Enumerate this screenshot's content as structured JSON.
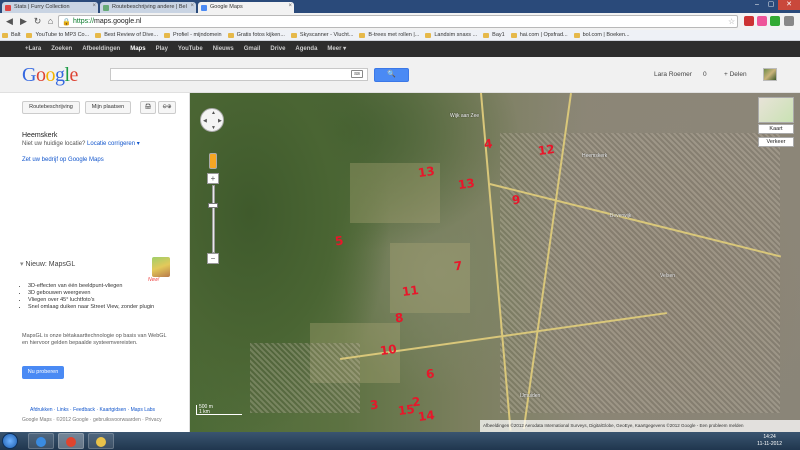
{
  "browser": {
    "tabs": [
      {
        "label": "Stats | Furry Collection",
        "color": "#d44"
      },
      {
        "label": "Routebeschrijving andere | Bel",
        "color": "#6a7"
      },
      {
        "label": "Google Maps",
        "color": "#4a8af4",
        "active": true
      }
    ],
    "url_scheme": "https://",
    "url_host": "maps.google.nl",
    "window_buttons": [
      "–",
      "▢",
      "✕"
    ]
  },
  "bookmarks": [
    "Balt",
    "YouTube to MP3 Co...",
    "Best Review of Dive...",
    "Profiel - mijndomein",
    "Gratis fotos kijken...",
    "Skyscanner - Vlucht...",
    "B-trees met rollen |...",
    "Landsim snaxs ...",
    "Bay1",
    "hai.com | Opsfrad...",
    "bol.com | Boeken..."
  ],
  "google_bar": {
    "items": [
      "+Lara",
      "Zoeken",
      "Afbeeldingen",
      "Maps",
      "Play",
      "YouTube",
      "Nieuws",
      "Gmail",
      "Drive",
      "Agenda",
      "Meer ▾"
    ],
    "selected": "Maps"
  },
  "header": {
    "logo": [
      "G",
      "o",
      "o",
      "g",
      "l",
      "e"
    ],
    "search_value": "",
    "search_button": "🔍",
    "username": "Lara Roemer",
    "notifications": "0",
    "share": "+ Delen"
  },
  "left_panel": {
    "buttons": [
      "Routebeschrijving",
      "Mijn plaatsen",
      "🖨",
      "⊖⊕"
    ],
    "place_title": "Heemskerk",
    "place_subtitle": "Niet uw huidige locatie?",
    "place_link": "Locatie corrigeren ▾",
    "mymaps_link": "Zet uw bedrijf op Google Maps",
    "mapsgl": {
      "title": "Nieuw: MapsGL",
      "badge": "New!",
      "features": [
        "3D-effecten van één beeldpunt-vliegen",
        "3D gebouwen weergeven",
        "Vliegen over 45° luchtfoto's",
        "Snel omlaag duiken naar Street View, zonder plugin"
      ],
      "description": "MapsGL is onze bètakaarttechnologie op basis van WebGL en hiervoor gelden bepaalde systeemvereisten.",
      "button": "Nu proberen"
    },
    "footer_links": "Afdrukken · Links · Feedback · Kaartgidsen · Maps Labs",
    "footer_copy": "Google Maps · ©2012 Google · gebruiksvoorwaarden · Privacy"
  },
  "map": {
    "labels": [
      "4",
      "12",
      "13",
      "13",
      "9",
      "5",
      "7",
      "11",
      "8",
      "10",
      "6",
      "3",
      "15",
      "2",
      "14"
    ],
    "places": [
      "Heemskerk",
      "Beverwijk",
      "Velsen",
      "Wijk aan Zee",
      "IJmuiden"
    ],
    "maptype": "Kaart",
    "traffic": "Verkeer",
    "scale": [
      "500 m",
      "1 km"
    ],
    "attribution": "Afbeeldingen ©2012 Aerodata International Surveys, DigitalGlobe, GeoEye, Kaartgegevens ©2012 Google - Een probleem melden"
  },
  "taskbar": {
    "apps": [
      {
        "name": "ie-icon",
        "color": "#3a8be0"
      },
      {
        "name": "chrome-icon",
        "color": "#e0442e"
      },
      {
        "name": "explorer-icon",
        "color": "#e9c24a"
      }
    ],
    "time": "14:24",
    "date": "11-11-2012"
  }
}
